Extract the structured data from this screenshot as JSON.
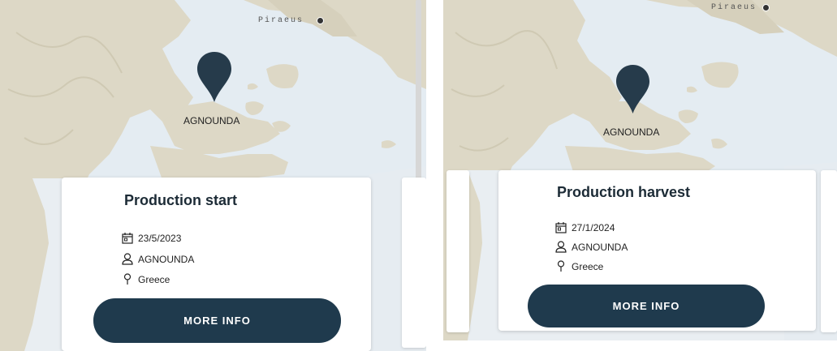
{
  "colors": {
    "accent": "#1f3a4d",
    "water": "#e4ecf2",
    "land": "#ddd8c6"
  },
  "panels": [
    {
      "port_label": "Piraeus",
      "marker_label": "AGNOUNDA",
      "card": {
        "title": "Production start",
        "date": "23/5/2023",
        "producer": "AGNOUNDA",
        "location": "Greece",
        "button_label": "MORE INFO",
        "date_icon": "calendar-icon",
        "producer_icon": "person-icon",
        "location_icon": "location-pin-icon"
      }
    },
    {
      "port_label": "Piraeus",
      "marker_label": "AGNOUNDA",
      "card": {
        "title": "Production harvest",
        "date": "27/1/2024",
        "producer": "AGNOUNDA",
        "location": "Greece",
        "button_label": "MORE INFO",
        "date_icon": "calendar-icon",
        "producer_icon": "person-icon",
        "location_icon": "location-pin-icon"
      }
    }
  ]
}
